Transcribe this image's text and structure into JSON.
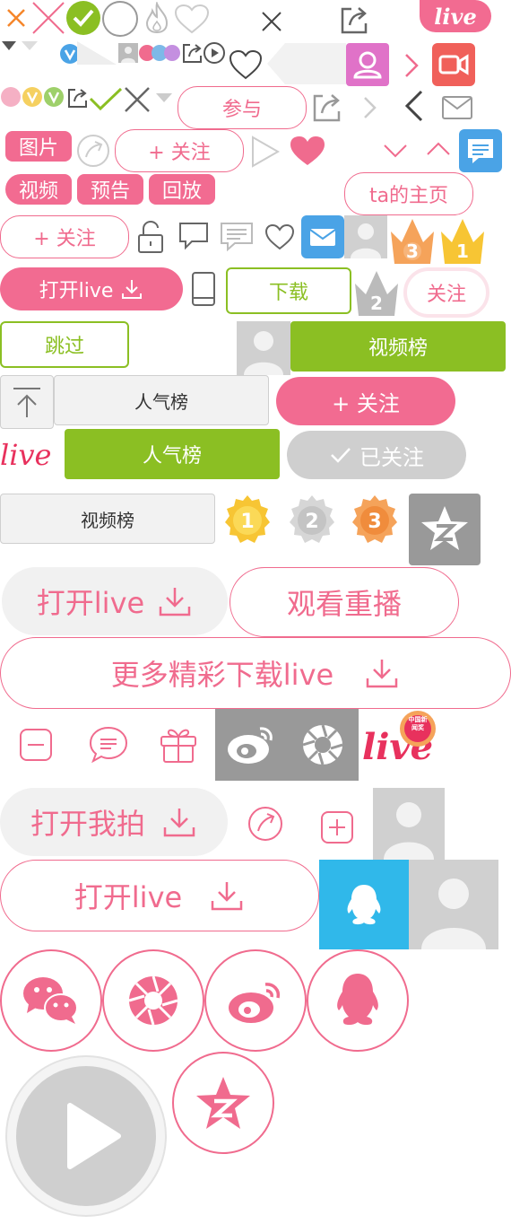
{
  "colors": {
    "pink": "#f06b8e",
    "green": "#8bbf23",
    "blue": "#3aa8e6",
    "red": "#f0605a",
    "gray": "#999999"
  },
  "labels": {
    "live": "live",
    "join": "参与",
    "pictures": "图片",
    "video": "视频",
    "preview": "预告",
    "replay": "回放",
    "follow": "关注",
    "plus_follow": "+ 关注",
    "ta_homepage": "ta的主页",
    "open_live": "打开live",
    "download": "下载",
    "skip": "跳过",
    "video_rank": "视频榜",
    "popularity_rank": "人气榜",
    "followed": "已关注",
    "watch_replay": "观看重播",
    "more_download": "更多精彩下载live",
    "open_wopai": "打开我拍",
    "news_badge": "中国新闻奖",
    "rank_1": "1",
    "rank_2": "2",
    "rank_3": "3"
  }
}
